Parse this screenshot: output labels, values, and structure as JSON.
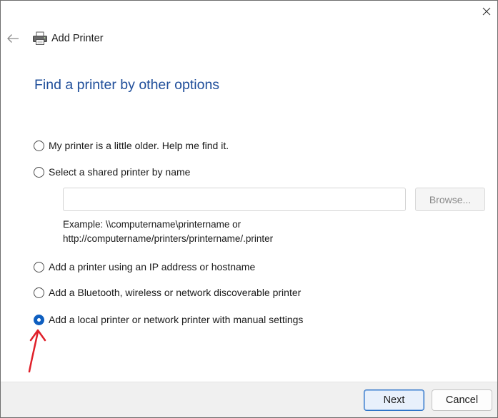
{
  "window": {
    "title": "Add Printer"
  },
  "page": {
    "heading": "Find a printer by other options"
  },
  "options": [
    {
      "label": "My printer is a little older. Help me find it.",
      "selected": false
    },
    {
      "label": "Select a shared printer by name",
      "selected": false
    },
    {
      "label": "Add a printer using an IP address or hostname",
      "selected": false
    },
    {
      "label": "Add a Bluetooth, wireless or network discoverable printer",
      "selected": false
    },
    {
      "label": "Add a local printer or network printer with manual settings",
      "selected": true
    }
  ],
  "shared_printer": {
    "value": "",
    "browse_label": "Browse...",
    "example_line1": "Example: \\\\computername\\printername or",
    "example_line2": "http://computername/printers/printername/.printer"
  },
  "footer": {
    "next_label": "Next",
    "cancel_label": "Cancel"
  },
  "icons": {
    "close": "close-icon",
    "back": "back-arrow-icon",
    "printer": "printer-icon",
    "annotation": "red-arrow-annotation-icon"
  },
  "colors": {
    "heading": "#1f4e9a",
    "accent": "#0f5fc0",
    "annotation": "#e0202a"
  }
}
